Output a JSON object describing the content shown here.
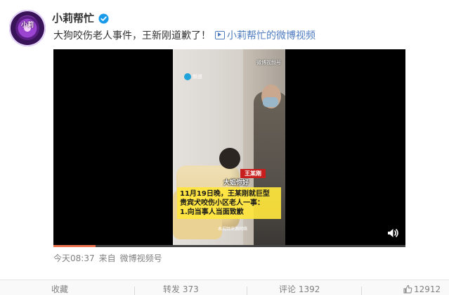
{
  "author": {
    "name": "小莉帮忙",
    "avatar_text": "小莉"
  },
  "post": {
    "text": "大狗咬伤老人事件，王新刚道歉了！",
    "video_link_label": "小莉帮忙的微博视频"
  },
  "video": {
    "logo_left": "频道",
    "logo_right": "微博视频号",
    "name_tag": "王某刚",
    "greeting": "大姐你好",
    "caption_lines": [
      "11月19日晚，王某刚就巨型",
      "贵宾犬咬伤小区老人一事：",
      "1.向当事人当面致歉"
    ],
    "credit": "本视频来源网络",
    "progress": 0.12
  },
  "meta": {
    "time": "今天08:37",
    "from_label": "来自",
    "source": "微博视频号"
  },
  "actions": {
    "favorite": "收藏",
    "repost": "转发 373",
    "comment": "评论 1392",
    "like": "12912"
  },
  "colors": {
    "accent": "#eb7350",
    "link": "#4f7cc0",
    "verified": "#1a9bea"
  }
}
